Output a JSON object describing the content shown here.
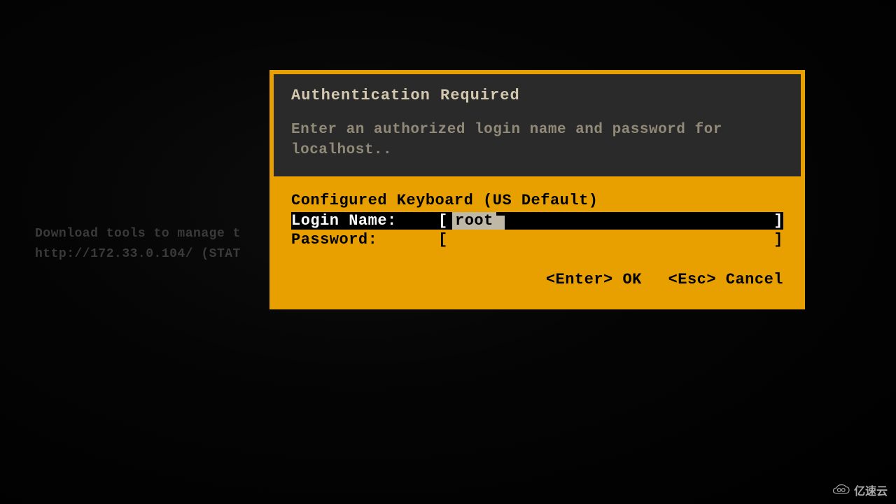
{
  "background": {
    "line1": "Download tools to manage t",
    "line2": "http://172.33.0.104/  (STAT"
  },
  "dialog": {
    "title": "Authentication Required",
    "subtitle": "Enter an authorized login name and password for localhost..",
    "keyboard_label": "Configured Keyboard (US Default)",
    "login_label": "Login Name:",
    "login_value": "root",
    "password_label": "Password:",
    "password_value": "",
    "bracket_open": "[",
    "bracket_close": "]",
    "action_ok": "<Enter> OK",
    "action_cancel": "<Esc> Cancel"
  },
  "watermark": {
    "text": "亿速云"
  }
}
